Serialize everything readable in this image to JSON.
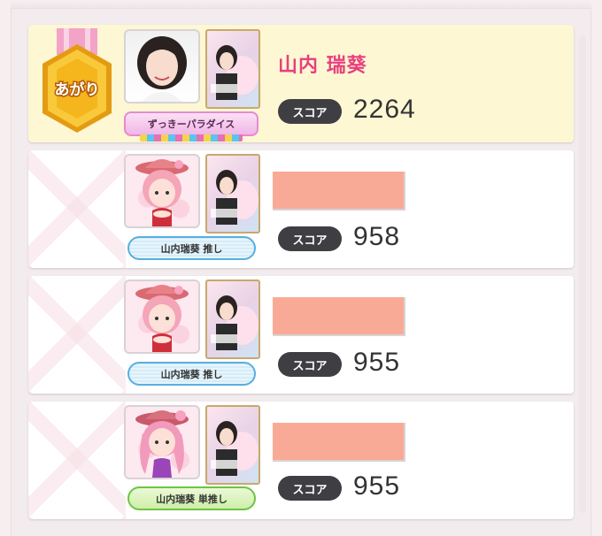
{
  "rows": [
    {
      "status_badge": "あがり",
      "name": "山内 瑞葵",
      "title_badge": "ずっきーパラダイス",
      "score_label": "スコア",
      "score": "2264"
    },
    {
      "tag": "山内瑞葵 推し",
      "score_label": "スコア",
      "score": "958"
    },
    {
      "tag": "山内瑞葵 推し",
      "score_label": "スコア",
      "score": "955"
    },
    {
      "tag": "山内瑞葵 単推し",
      "score_label": "スコア",
      "score": "955"
    }
  ],
  "colors": {
    "winner_bg": "#fdf7d3",
    "name_pink": "#e8407e",
    "score_pill": "#3f3f43",
    "redaction": "#f9aa97",
    "tag_blue": "#58aee0",
    "tag_green": "#6cc444",
    "medal_gold": "#f5b51c",
    "medal_ribbon": "#f3a2c8"
  },
  "icons": {
    "medal": "gold-hexagon-medal-icon",
    "avatar_photo": "member-photo",
    "avatar_character": "pink-hat-character-avatar",
    "card": "member-card-thumbnail"
  }
}
